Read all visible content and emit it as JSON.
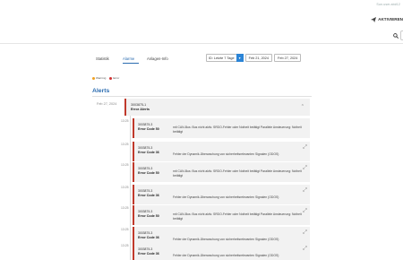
{
  "topbar": {
    "user": "Sun.user.ab#12",
    "action_label": "AKTIVIEREN"
  },
  "tabs": [
    {
      "label": "Statistik"
    },
    {
      "label": "Alarme"
    },
    {
      "label": "Anlagen-Info"
    }
  ],
  "filters": {
    "range": "ID: Letzte 7 Tage",
    "date_from": "Feb 21, 2024",
    "date_to": "Feb 27, 2024"
  },
  "legend": [
    {
      "label": "Warning",
      "color": "#f0a020"
    },
    {
      "label": "Error",
      "color": "#d03030"
    }
  ],
  "title": "Alerts",
  "group": {
    "date": "Feb 27, 2024",
    "id": "3003875-1",
    "label": "Error Alerts"
  },
  "alerts": [
    {
      "time": "13:25",
      "id": "3003875-3",
      "code": "Error Code 50",
      "message": "mit CAN-Bus: Bus nicht aktiv. SRDO-Fehler oder Notheit betätigt Parallele Ansteuerung: Notheit betätigt"
    },
    {
      "time": "13:25",
      "id": "3003875-3",
      "code": "Error Code 36",
      "message": "Fehler der Dynamik-Überwachung von sicherheitsrelevanten Signalen (ODOS)"
    },
    {
      "time": "13:25",
      "id": "3003875-3",
      "code": "Error Code 50",
      "message": "mit CAN-Bus: Bus nicht aktiv. SRDO-Fehler oder Notheit betätigt Parallele Ansteuerung: Notheit betätigt"
    },
    {
      "time": "13:25",
      "id": "3003875-3",
      "code": "Error Code 36",
      "message": "Fehler der Dynamik-Überwachung von sicherheitsrelevanten Signalen (ODOS)"
    },
    {
      "time": "13:25",
      "id": "3003875-3",
      "code": "Error Code 50",
      "message": "mit CAN-Bus: Bus nicht aktiv. SRDO-Fehler oder Notheit betätigt Parallele Ansteuerung: Notheit betätigt"
    },
    {
      "time": "13:25",
      "id": "3003875-3",
      "code": "Error Code 36",
      "message": "Fehler der Dynamik-Überwachung von sicherheitsrelevanten Signalen (ODOS)"
    },
    {
      "time": "13:25",
      "id": "3003875-3",
      "code": "Error Code 36",
      "message": "Fehler der Dynamik-Überwachung von sicherheitsrelevanten Signalen (ODOS)"
    }
  ]
}
